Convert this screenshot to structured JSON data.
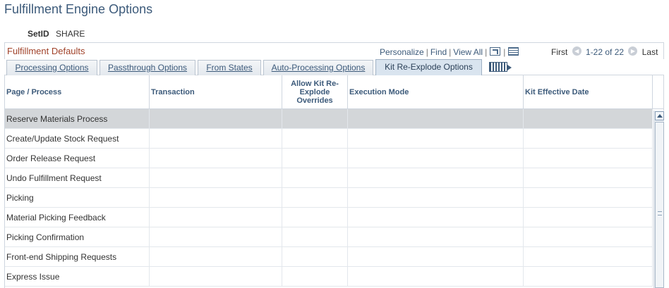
{
  "page": {
    "title": "Fulfillment Engine Options"
  },
  "setid": {
    "label": "SetID",
    "value": "SHARE"
  },
  "grid": {
    "title": "Fulfillment Defaults",
    "personalize": "Personalize",
    "find": "Find",
    "view_all": "View All",
    "first": "First",
    "count": "1-22 of 22",
    "last": "Last"
  },
  "tabs": [
    {
      "label": "Processing Options",
      "active": false
    },
    {
      "label": "Passthrough Options",
      "active": false
    },
    {
      "label": "From States",
      "active": false
    },
    {
      "label": "Auto-Processing Options",
      "active": false
    },
    {
      "label": "Kit Re-Explode Options",
      "active": true
    }
  ],
  "columns": {
    "page_process": "Page / Process",
    "transaction": "Transaction",
    "allow_kit": "Allow Kit Re-Explode Overrides",
    "execution_mode": "Execution Mode",
    "kit_effective_date": "Kit Effective Date"
  },
  "rows": [
    {
      "page_process": "Reserve Materials Process",
      "selected": true
    },
    {
      "page_process": "Create/Update Stock Request",
      "selected": false
    },
    {
      "page_process": "Order Release Request",
      "selected": false
    },
    {
      "page_process": "Undo Fulfillment Request",
      "selected": false
    },
    {
      "page_process": "Picking",
      "selected": false
    },
    {
      "page_process": "Material Picking Feedback",
      "selected": false
    },
    {
      "page_process": "Picking Confirmation",
      "selected": false
    },
    {
      "page_process": "Front-end Shipping Requests",
      "selected": false
    },
    {
      "page_process": "Express Issue",
      "selected": false
    }
  ],
  "icons": {
    "zoom": "zoom-grid-icon",
    "download": "download-spreadsheet-icon",
    "prev": "previous-arrow-icon",
    "next": "next-arrow-icon",
    "show_all_tabs": "show-all-columns-icon",
    "scroll_up": "scroll-up-arrow-icon"
  }
}
